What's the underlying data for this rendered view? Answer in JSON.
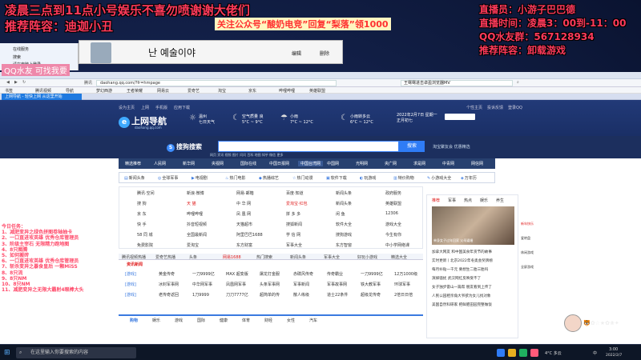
{
  "overlay": {
    "line1": "凌晨三点到11点小号娱乐不喜勿喷谢谢大佬们",
    "line2": "推荐阵容：迪迦小丑",
    "ad": "关注公众号“酸奶电竞”回复“梨落”领1000",
    "right": [
      "直播员：小游子巴巴德",
      "直播时间：凌晨3：00到-11：00",
      "QQ水友群：567128934",
      "推荐阵容：卸载游戏"
    ],
    "qq_tag": "QQ水友 可找我要",
    "todo_title": "今日任务：",
    "todo": [
      "1、减肥变异之绿色拼图卷轴抽卡",
      "2、一口直进攻英雄 优秀仓库管理员",
      "3、阶级主宰石 无限精力跑地图",
      "4、8只图腾",
      "5、如何搬砖",
      "6、一口直进攻英雄 优秀仓库管理员",
      "7、斩杀变异之暴食皇后 一颗MiSS",
      "8、8只流",
      "9、8只NM",
      "10、8只NM",
      "11、减肥变异之无限大霸射4眼棒大头"
    ]
  },
  "behind_window": {
    "korean_title": "난 예술이야",
    "edit": "编辑",
    "delete": "删除"
  },
  "left_panel": [
    "在线服务",
    "搜索",
    "请在电脑上登录"
  ],
  "browser": {
    "tab_title": "上网导航 - 轻快上网 从这里开始",
    "url": "daohang.qq.com/?fr=hmpage",
    "search_bar_text": "王骞骞进击卓盈浏览器MV",
    "bookmarks": [
      "书签",
      "腾讯视频",
      "导航",
      "梦幻西游",
      "王者荣耀",
      "网易云",
      "爱奇艺",
      "淘宝",
      "京东",
      "哔哩哔哩",
      "英雄联盟"
    ],
    "addr_left": "腾讯",
    "addr_right": "搜"
  },
  "page": {
    "top_links": [
      "设为主页",
      "上网",
      "手机版",
      "应用下载"
    ],
    "top_links_right": [
      "个性主页",
      "投诉反馈",
      "登录QQ"
    ],
    "logo": "上网导航",
    "logo_sub": "daohang.qq.com",
    "weather": [
      {
        "city": "温州",
        "desc": "七日天气",
        "temp": ""
      },
      {
        "city": "空气质量",
        "desc": "良",
        "temp": "5°C ~ 9°C"
      },
      {
        "city": "小雨",
        "desc": "",
        "temp": "7°C ~ 12°C"
      },
      {
        "city": "小雨转多云",
        "desc": "",
        "temp": "6°C ~ 12°C"
      }
    ],
    "date": "2022年2月7日 星期一",
    "date2": "正月初七",
    "search_brand": "搜狗搜索",
    "search_btn": "搜索",
    "search_opts": "网页  资讯  视频  图片  问问  百科  地图  知乎  微信  更多",
    "search_right": "淘宝聚友会 优惠精选",
    "nav": [
      "精选推荐",
      "人民网",
      "新华网",
      "央视网",
      "国际在线",
      "中国日报网",
      "中国台湾网",
      "中国网",
      "光明网",
      "央广网",
      "求是网",
      "中青网",
      "网信网"
    ],
    "icon_bar": [
      {
        "icon": "▤",
        "label": "新闻头条"
      },
      {
        "icon": "◎",
        "label": "全球军事"
      },
      {
        "icon": "▶",
        "label": "电视剧"
      },
      {
        "icon": "♨",
        "label": "热门电影"
      },
      {
        "icon": "◆",
        "label": "热播综艺"
      },
      {
        "icon": "☆",
        "label": "热门动漫"
      },
      {
        "icon": "▣",
        "label": "软件下载"
      },
      {
        "icon": "◐",
        "label": "玩游戏"
      },
      {
        "icon": "▥",
        "label": "特价购物"
      },
      {
        "icon": "✎",
        "label": "小游戏大全"
      },
      {
        "icon": "◈",
        "label": "万年历"
      }
    ],
    "grid": [
      [
        "腾讯·空间",
        "新浪·微博",
        "网易·邮箱",
        "百度·知道",
        "新闻头条",
        "政府服务"
      ],
      [
        "搜  狗",
        "天  猫",
        "中 华 网",
        "爱淘宝·红包",
        "新闻头条",
        "英雄联盟"
      ],
      [
        "京  东",
        "哔哩哔哩",
        "凤  凰  网",
        "拼 多 多",
        "闲  鱼",
        "12306"
      ],
      [
        "快  手",
        "抖音短视频",
        "天猫超市",
        "搜狐新闻",
        "软件大全",
        "游戏大全"
      ],
      [
        "58 同 城",
        "全国最新闻",
        "阿里巴巴1688",
        "学 信 网",
        "搜狗游戏",
        "今生有你"
      ],
      [
        "免费影院",
        "爱淘宝",
        "东方财富",
        "军事大全",
        "东方智窗",
        "中小学网络课"
      ]
    ],
    "mid_bar": [
      "腾讯视频热播",
      "爱奇艺热播",
      "头条",
      "网易1688",
      "热门搜索",
      "新闻头条",
      "军事大全",
      "好玩小游戏",
      "精选大全"
    ],
    "zixun_title": "资讯新闻",
    "zixun": [
      [
        "[游戏]",
        "黄金传奇",
        "一刀9999亿",
        "MAX 超变版",
        "屠龙打金服",
        "赤碟风传奇",
        "传奇霸业",
        "一刀9999亿",
        "12万1000级"
      ],
      [
        "[游戏]",
        "冰封军事网",
        "中华网军事",
        "凤凰网军事",
        "头条军事网",
        "军事新闻",
        "军事故事网",
        "铁大教军事",
        "环球军事"
      ],
      [
        "[游戏]",
        "老传奇返回",
        "1刀9999",
        "刀刀7777亿",
        "超简单的传",
        "散人练级",
        "道士22条件",
        "超级龙传奇",
        "2倍日日倍"
      ]
    ],
    "bottom_tabs": [
      "购物",
      "娱乐",
      "游戏",
      "国际",
      "健康",
      "体育",
      "财经",
      "女性",
      "汽车"
    ],
    "news_tabs": [
      "推荐",
      "军事",
      "热点",
      "娱乐",
      "养生"
    ],
    "news_caption": "单身女子过年回家 父母逼婚",
    "news_list": [
      "加拿大网友 和中国美食年货节的故事",
      "实时更新丨北京2022年冬奥会奖牌榜",
      "每月补贴一千元 要想生二胎三胎吗",
      "演绎骚扰 武汉网红反映受不了",
      "女子独步雷山一篇帮 朋友看到上传了",
      "人民公园相亲角大爷欲为女儿找对象",
      "美国自然科研家 把鲜肥田园完整做饭"
    ],
    "side_pop": [
      "新年快乐",
      "爱转盘",
      "休闲游戏",
      "全屏游戏"
    ]
  },
  "emotes": "🐯✿☆★✿❀✦",
  "taskbar": {
    "search": "在这里输入你要搜索的内容",
    "weather": "4°C 多云",
    "time": "3:00",
    "date": "2022/2/7",
    "lang": "中"
  }
}
